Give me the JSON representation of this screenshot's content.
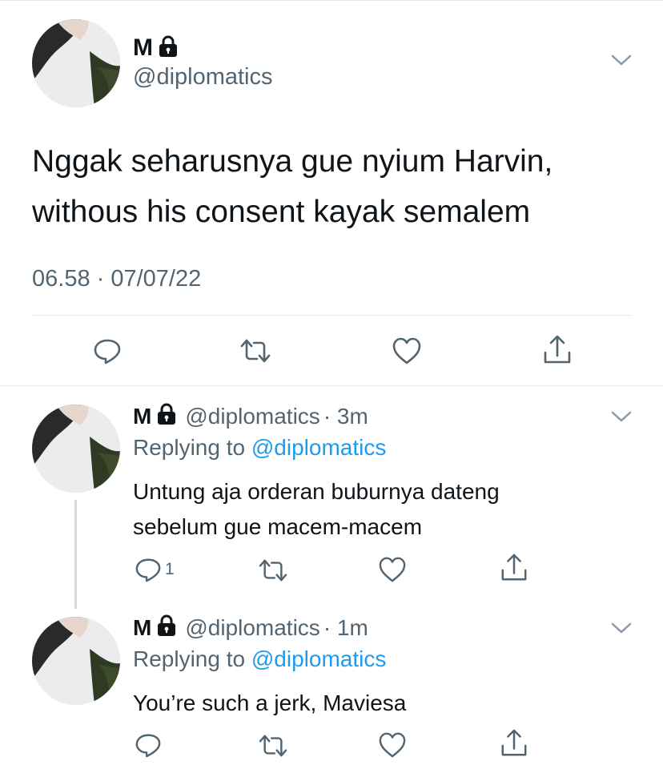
{
  "main_tweet": {
    "name": "M",
    "handle": "@diplomatics",
    "text_line1": "Nggak seharusnya gue nyium Harvin,",
    "text_line2": "withous his consent kayak semalem",
    "timestamp": "06.58 · 07/07/22",
    "icons": [
      "lock-icon",
      "chevron-down-icon",
      "reply-icon",
      "retweet-icon",
      "like-icon",
      "share-icon"
    ]
  },
  "replies": [
    {
      "name": "M",
      "handle": "@diplomatics",
      "time": "· 3m",
      "replying_prefix": "Replying to",
      "replying_handle": "@diplomatics",
      "text_line1": "Untung aja orderan buburnya dateng",
      "text_line2": "sebelum gue macem-macem",
      "reply_count": "1"
    },
    {
      "name": "M",
      "handle": "@diplomatics",
      "time": "· 1m",
      "replying_prefix": "Replying to",
      "replying_handle": "@diplomatics",
      "text_line1": "You’re such a jerk, Maviesa",
      "reply_count": ""
    }
  ],
  "colors": {
    "text": "#0f1419",
    "muted": "#536471",
    "link": "#1d9bf0",
    "divider": "#e6e9ec"
  }
}
